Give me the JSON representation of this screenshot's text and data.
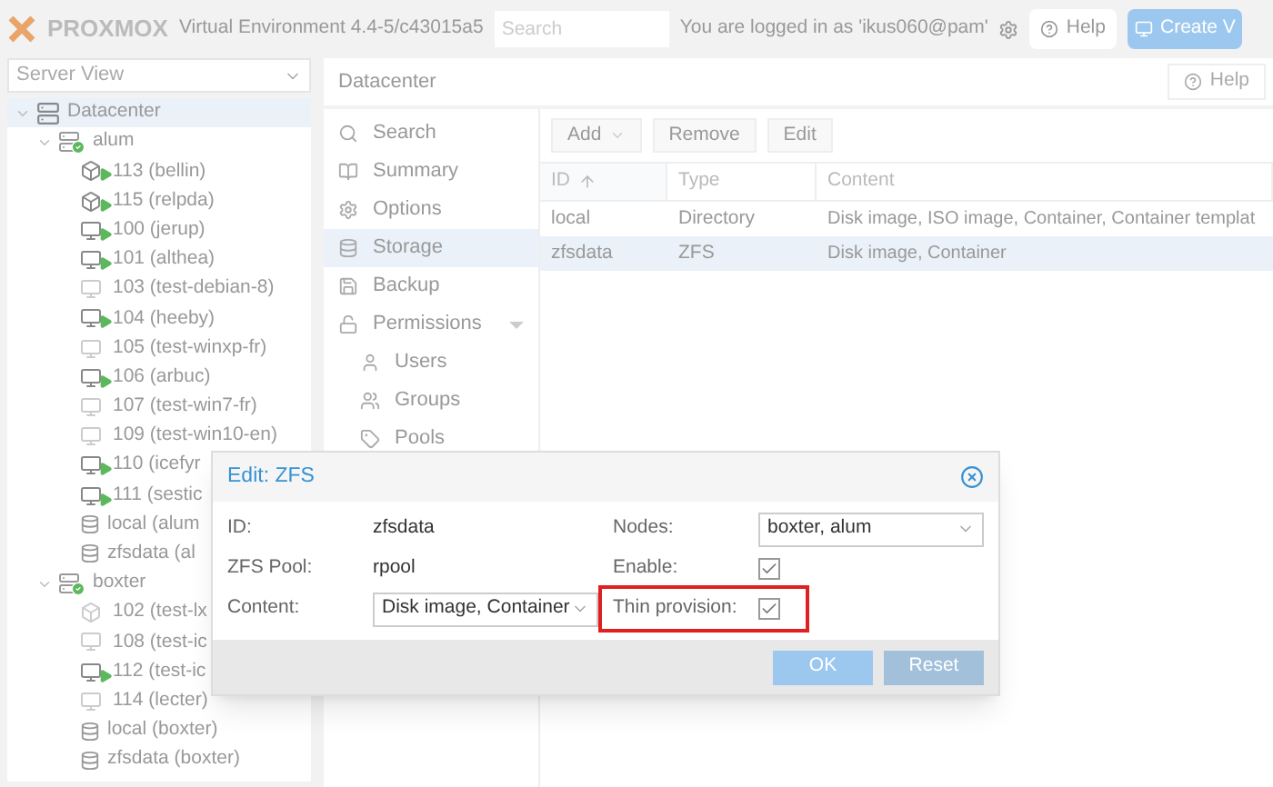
{
  "header": {
    "logo": "PROXMOX",
    "version": "Virtual Environment 4.4-5/c43015a5",
    "search": {
      "placeholder": "Search"
    },
    "login": "You are logged in as 'ikus060@pam'",
    "help": "Help",
    "create": "Create V"
  },
  "sidebar": {
    "view": "Server View",
    "tree": [
      {
        "kind": "datacenter",
        "label": "Datacenter",
        "selected": true,
        "expanded": true,
        "children": [
          {
            "kind": "node",
            "label": "alum",
            "selected": false,
            "expanded": true,
            "children": [
              {
                "kind": "container",
                "label": "113 (bellin)",
                "running": true
              },
              {
                "kind": "container",
                "label": "115 (relpda)",
                "running": true
              },
              {
                "kind": "vm",
                "label": "100 (jerup)",
                "running": true
              },
              {
                "kind": "vm",
                "label": "101 (althea)",
                "running": true
              },
              {
                "kind": "vm",
                "label": "103 (test-debian-8)",
                "running": false
              },
              {
                "kind": "vm",
                "label": "104 (heeby)",
                "running": true
              },
              {
                "kind": "vm",
                "label": "105 (test-winxp-fr)",
                "running": false
              },
              {
                "kind": "vm",
                "label": "106 (arbuc)",
                "running": true
              },
              {
                "kind": "vm",
                "label": "107 (test-win7-fr)",
                "running": false
              },
              {
                "kind": "vm",
                "label": "109 (test-win10-en)",
                "running": false
              },
              {
                "kind": "vm",
                "label": "110 (icefyr",
                "running": true
              },
              {
                "kind": "vm",
                "label": "111 (sestic",
                "running": true
              },
              {
                "kind": "storage",
                "label": "local (alum"
              },
              {
                "kind": "storage",
                "label": "zfsdata (al"
              }
            ]
          },
          {
            "kind": "node",
            "label": "boxter",
            "selected": false,
            "expanded": true,
            "children": [
              {
                "kind": "container",
                "label": "102 (test-lx",
                "running": false
              },
              {
                "kind": "vm",
                "label": "108 (test-ic",
                "running": false
              },
              {
                "kind": "vm",
                "label": "112 (test-ic",
                "running": true
              },
              {
                "kind": "vm",
                "label": "114 (lecter)",
                "running": false
              },
              {
                "kind": "storage",
                "label": "local (boxter)"
              },
              {
                "kind": "storage",
                "label": "zfsdata (boxter)"
              }
            ]
          }
        ]
      }
    ]
  },
  "content": {
    "title": "Datacenter",
    "help": "Help",
    "menu": [
      {
        "label": "Search",
        "selected": false
      },
      {
        "label": "Summary",
        "selected": false
      },
      {
        "label": "Options",
        "selected": false
      },
      {
        "label": "Storage",
        "selected": true
      },
      {
        "label": "Backup",
        "selected": false
      },
      {
        "label": "Permissions",
        "selected": false,
        "expanded": true,
        "children": [
          {
            "label": "Users",
            "selected": false
          },
          {
            "label": "Groups",
            "selected": false
          },
          {
            "label": "Pools",
            "selected": false
          }
        ]
      }
    ],
    "toolbar": [
      {
        "label": "Add",
        "kind": "menu"
      },
      {
        "label": "Remove",
        "kind": "plain"
      },
      {
        "label": "Edit",
        "kind": "plain"
      }
    ],
    "table": {
      "columns": [
        {
          "label": "ID",
          "sorted": true
        },
        {
          "label": "Type",
          "sorted": false
        },
        {
          "label": "Content",
          "sorted": false
        }
      ],
      "rows": [
        {
          "cells": [
            "local",
            "Directory",
            "Disk image, ISO image, Container, Container templat"
          ],
          "selected": false
        },
        {
          "cells": [
            "zfsdata",
            "ZFS",
            "Disk image, Container"
          ],
          "selected": true
        }
      ]
    }
  },
  "dialog": {
    "title": "Edit: ZFS",
    "left": [
      {
        "kind": "text",
        "label": "ID:",
        "value": "zfsdata"
      },
      {
        "kind": "text",
        "label": "ZFS Pool:",
        "value": "rpool"
      },
      {
        "kind": "select",
        "label": "Content:",
        "value": "Disk image, Container"
      }
    ],
    "right": [
      {
        "kind": "select",
        "label": "Nodes:",
        "value": "boxter, alum"
      },
      {
        "kind": "checkbox",
        "label": "Enable:",
        "checked": true
      },
      {
        "kind": "checkbox",
        "label": "Thin provision:",
        "checked": true,
        "highlighted": true
      }
    ],
    "buttons": [
      {
        "label": "OK",
        "kind": "primary"
      },
      {
        "label": "Reset",
        "kind": "default"
      }
    ]
  }
}
